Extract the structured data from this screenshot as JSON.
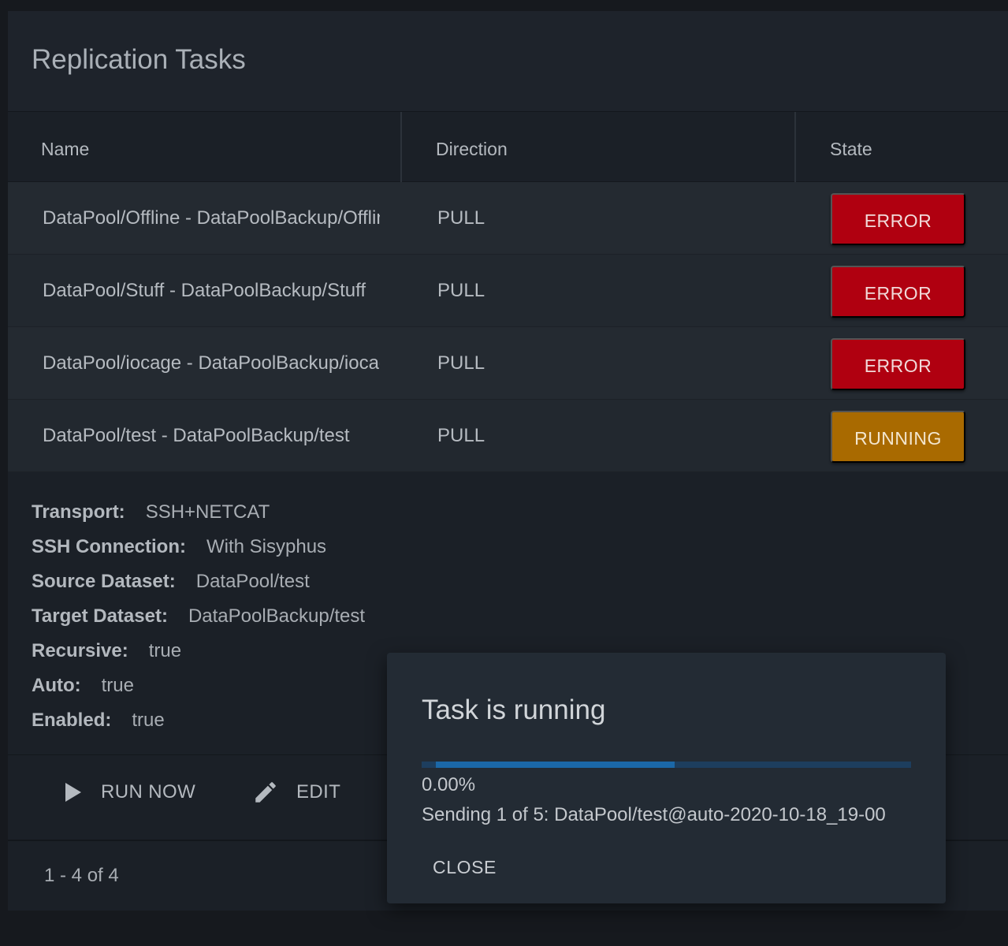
{
  "card": {
    "title": "Replication Tasks"
  },
  "table": {
    "columns": [
      "Name",
      "Direction",
      "State"
    ],
    "rows": [
      {
        "name": "DataPool/Offline - DataPoolBackup/Offline",
        "direction": "PULL",
        "state": "ERROR"
      },
      {
        "name": "DataPool/Stuff - DataPoolBackup/Stuff",
        "direction": "PULL",
        "state": "ERROR"
      },
      {
        "name": "DataPool/iocage - DataPoolBackup/iocage",
        "direction": "PULL",
        "state": "ERROR"
      },
      {
        "name": "DataPool/test - DataPoolBackup/test",
        "direction": "PULL",
        "state": "RUNNING"
      }
    ]
  },
  "details": [
    {
      "label": "Transport:",
      "value": "SSH+NETCAT"
    },
    {
      "label": "SSH Connection:",
      "value": "With Sisyphus"
    },
    {
      "label": "Source Dataset:",
      "value": "DataPool/test"
    },
    {
      "label": "Target Dataset:",
      "value": "DataPoolBackup/test"
    },
    {
      "label": "Recursive:",
      "value": "true"
    },
    {
      "label": "Auto:",
      "value": "true"
    },
    {
      "label": "Enabled:",
      "value": "true"
    }
  ],
  "actions": {
    "run_now": "RUN NOW",
    "edit": "EDIT"
  },
  "footer": {
    "pager": "1 - 4 of 4"
  },
  "dialog": {
    "title": "Task is running",
    "progress_percent": "0.00%",
    "progress_fraction": 0.0,
    "message": "Sending 1 of 5: DataPool/test@auto-2020-10-18_19-00",
    "close_label": "CLOSE"
  },
  "colors": {
    "error": "#b00010",
    "running": "#a96a00",
    "progress_track": "#1d3e5e",
    "progress_fill": "#1b68a8"
  },
  "icons": {
    "run_now": "play-icon",
    "edit": "pencil-icon"
  }
}
